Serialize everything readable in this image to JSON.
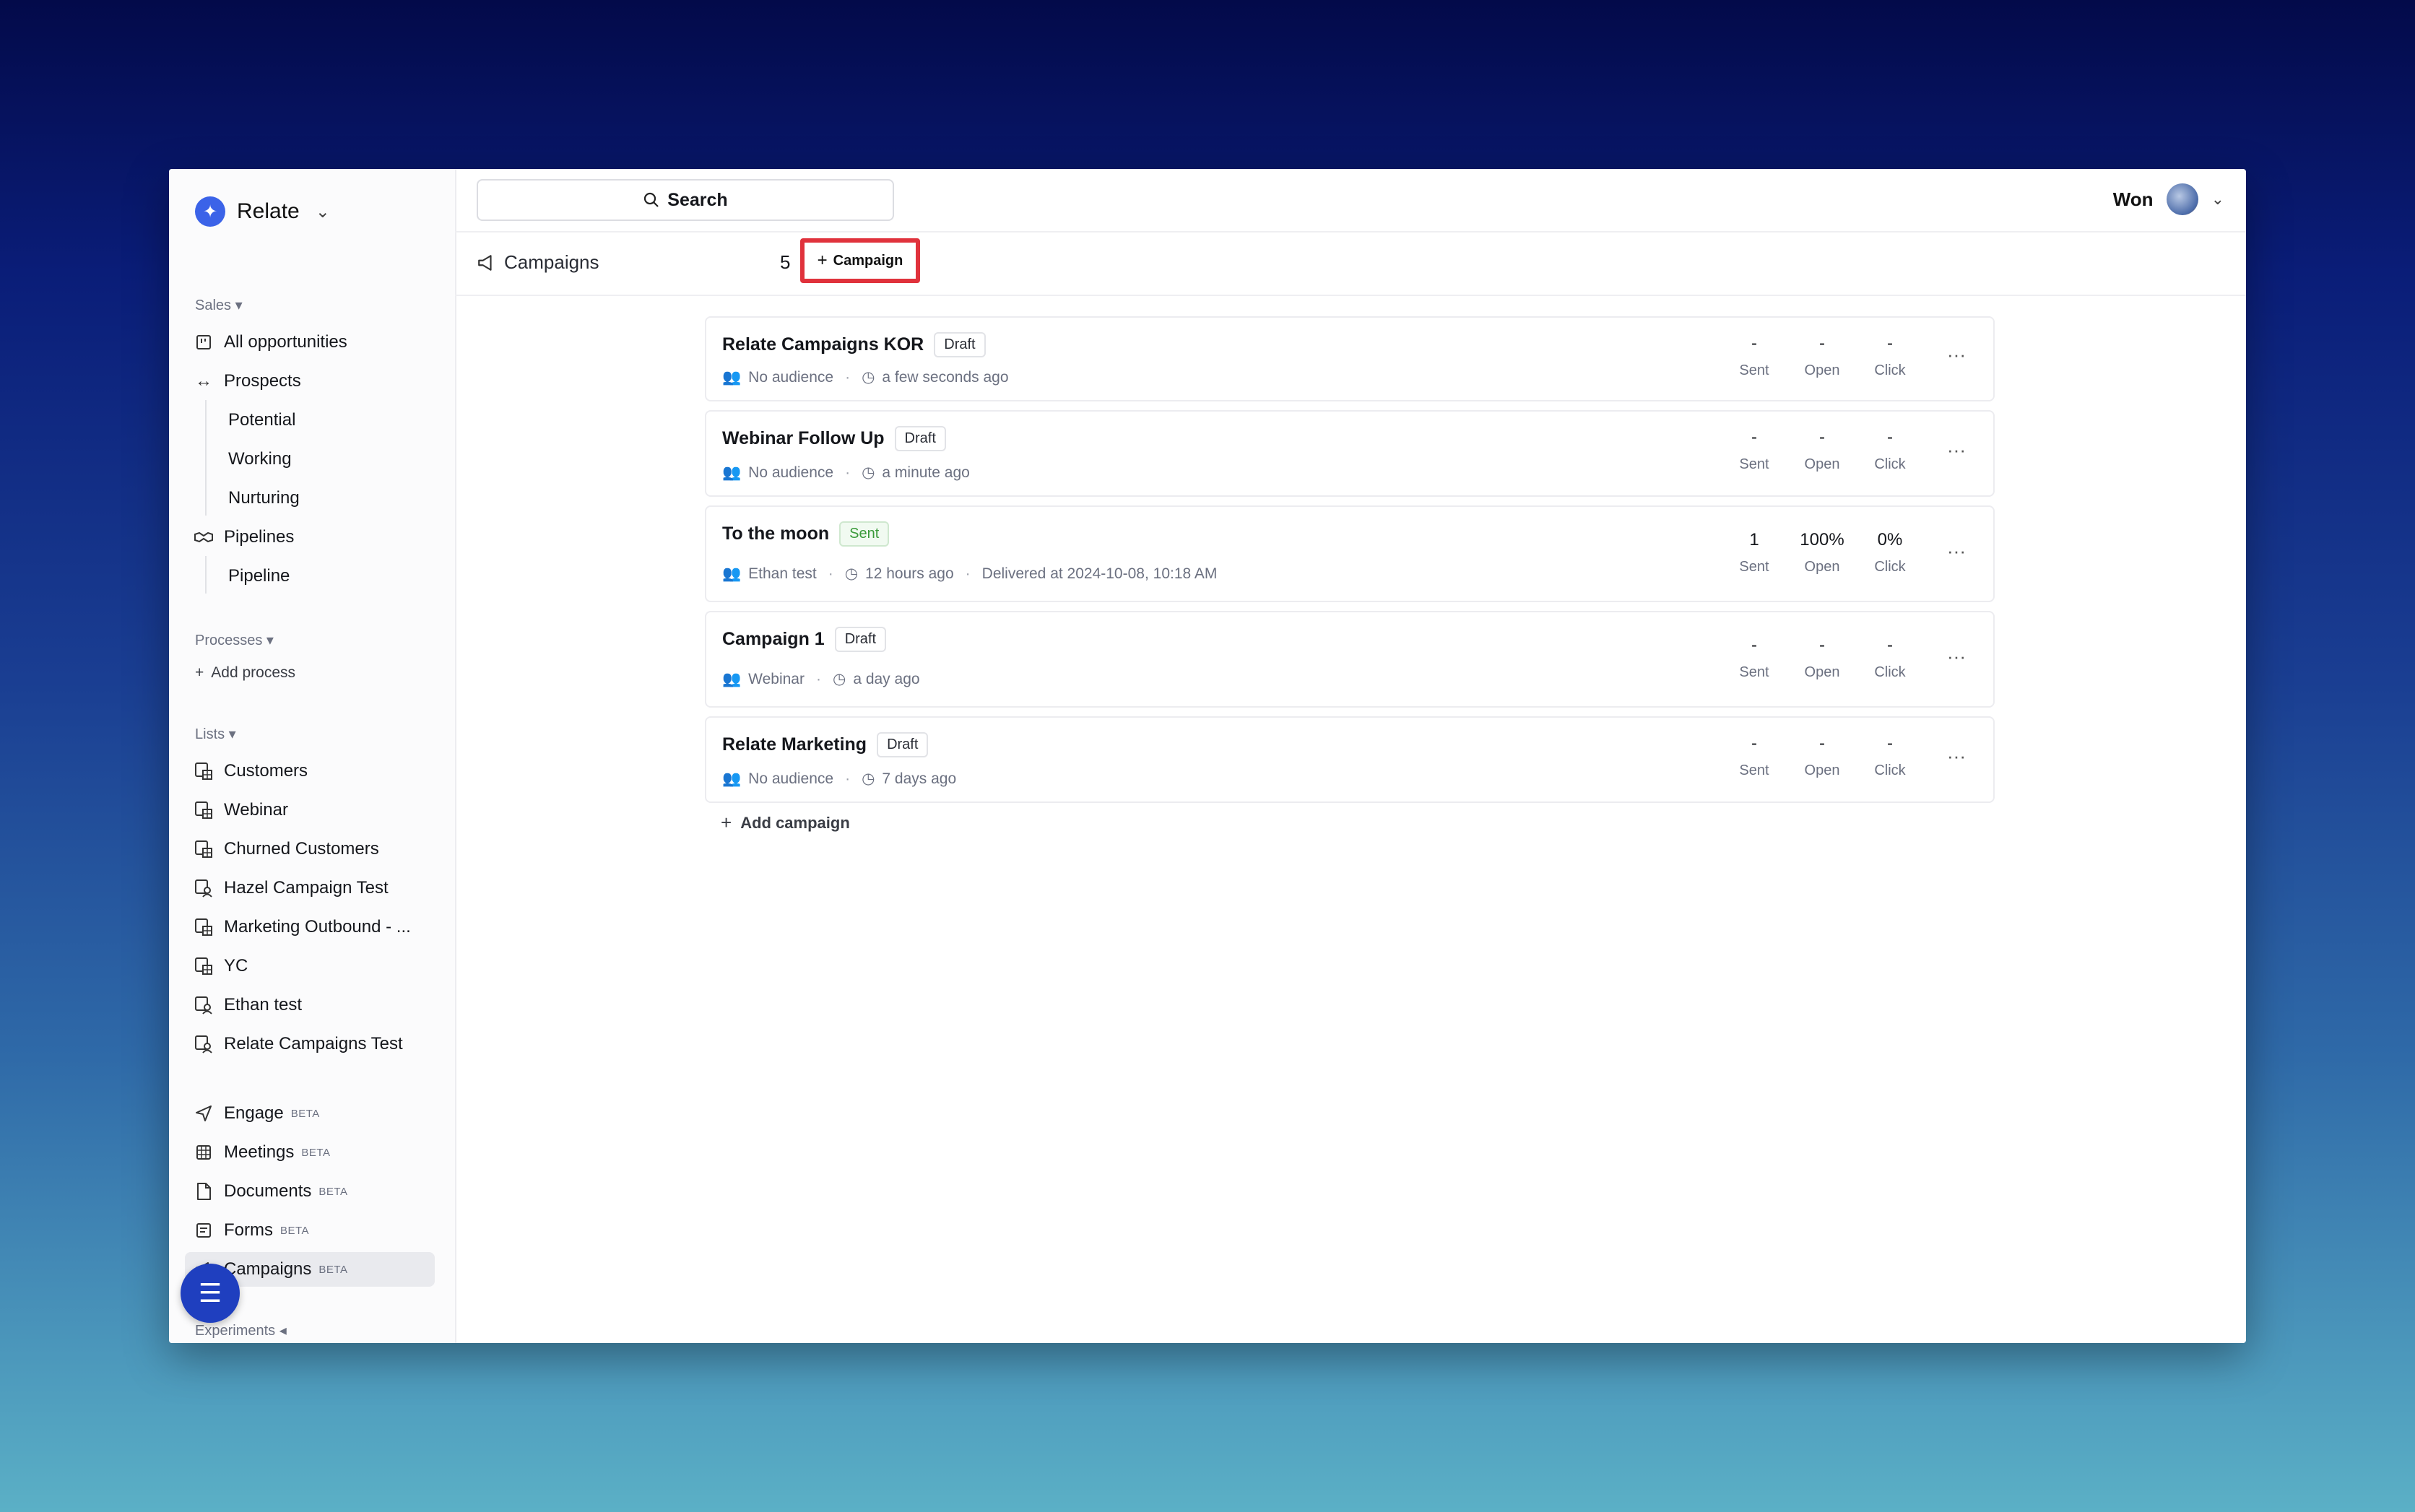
{
  "brand": {
    "name": "Relate"
  },
  "sidebar": {
    "sales_label": "Sales",
    "sales_items": [
      {
        "label": "All opportunities"
      },
      {
        "label": "Prospects"
      },
      {
        "label": "Potential"
      },
      {
        "label": "Working"
      },
      {
        "label": "Nurturing"
      },
      {
        "label": "Pipelines"
      },
      {
        "label": "Pipeline"
      }
    ],
    "processes_label": "Processes",
    "add_process_label": "Add process",
    "lists_label": "Lists",
    "lists": [
      {
        "label": "Customers"
      },
      {
        "label": "Webinar"
      },
      {
        "label": "Churned Customers"
      },
      {
        "label": "Hazel Campaign Test"
      },
      {
        "label": "Marketing Outbound - ..."
      },
      {
        "label": "YC"
      },
      {
        "label": "Ethan test"
      },
      {
        "label": "Relate Campaigns Test"
      }
    ],
    "tools": [
      {
        "label": "Engage",
        "badge": "BETA"
      },
      {
        "label": "Meetings",
        "badge": "BETA"
      },
      {
        "label": "Documents",
        "badge": "BETA"
      },
      {
        "label": "Forms",
        "badge": "BETA"
      },
      {
        "label": "Campaigns",
        "badge": "BETA"
      }
    ],
    "experiments_label": "Experiments"
  },
  "topbar": {
    "search_label": "Search",
    "user_name": "Won"
  },
  "subbar": {
    "title": "Campaigns",
    "count": "5",
    "new_label": "Campaign"
  },
  "campaigns": [
    {
      "name": "Relate Campaigns KOR",
      "status": "Draft",
      "audience": "No audience",
      "time": "a few seconds ago",
      "delivered": "",
      "sent": "-",
      "open": "-",
      "click": "-"
    },
    {
      "name": "Webinar Follow Up",
      "status": "Draft",
      "audience": "No audience",
      "time": "a minute ago",
      "delivered": "",
      "sent": "-",
      "open": "-",
      "click": "-"
    },
    {
      "name": "To the moon",
      "status": "Sent",
      "audience": "Ethan test",
      "time": "12 hours ago",
      "delivered": "Delivered at 2024-10-08, 10:18 AM",
      "sent": "1",
      "open": "100%",
      "click": "0%"
    },
    {
      "name": "Campaign 1",
      "status": "Draft",
      "audience": "Webinar",
      "time": "a day ago",
      "delivered": "",
      "sent": "-",
      "open": "-",
      "click": "-"
    },
    {
      "name": "Relate Marketing",
      "status": "Draft",
      "audience": "No audience",
      "time": "7 days ago",
      "delivered": "",
      "sent": "-",
      "open": "-",
      "click": "-"
    }
  ],
  "stat_labels": {
    "sent": "Sent",
    "open": "Open",
    "click": "Click"
  },
  "add_campaign_label": "Add campaign",
  "colors": {
    "accent": "#3b63e8",
    "highlight": "#e0323c",
    "sent_badge": "#3a9a3a"
  }
}
